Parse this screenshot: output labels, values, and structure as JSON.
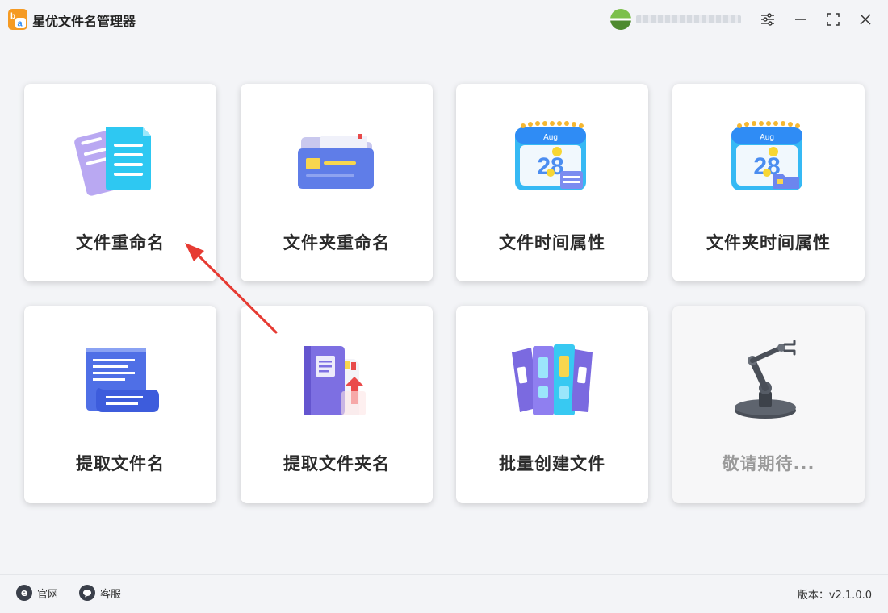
{
  "app": {
    "title": "星优文件名管理器",
    "logo_icon": "logo-ba-icon"
  },
  "titlebar": {
    "buttons": [
      {
        "icon": "settings-sliders-icon"
      },
      {
        "icon": "minimize-icon"
      },
      {
        "icon": "maximize-icon"
      },
      {
        "icon": "close-icon"
      }
    ]
  },
  "tiles": [
    {
      "label": "文件重命名",
      "icon": "documents-icon",
      "enabled": true
    },
    {
      "label": "文件夹重命名",
      "icon": "folder-icon",
      "enabled": true
    },
    {
      "label": "文件时间属性",
      "icon": "calendar-document-icon",
      "enabled": true
    },
    {
      "label": "文件夹时间属性",
      "icon": "calendar-folder-icon",
      "enabled": true
    },
    {
      "label": "提取文件名",
      "icon": "scroll-list-icon",
      "enabled": true
    },
    {
      "label": "提取文件夹名",
      "icon": "book-folder-export-icon",
      "enabled": true
    },
    {
      "label": "批量创建文件",
      "icon": "binders-icon",
      "enabled": true
    },
    {
      "label": "敬请期待...",
      "icon": "robot-arm-icon",
      "enabled": false
    }
  ],
  "calendar": {
    "month": "Aug",
    "day": "28"
  },
  "footer": {
    "website_label": "官网",
    "website_icon_glyph": "e",
    "support_label": "客服",
    "version": "版本：v2.1.0.0"
  },
  "colors": {
    "accent_blue": "#2f8cf5",
    "annotation_arrow": "#e63b33",
    "logo_orange": "#f59a23"
  }
}
